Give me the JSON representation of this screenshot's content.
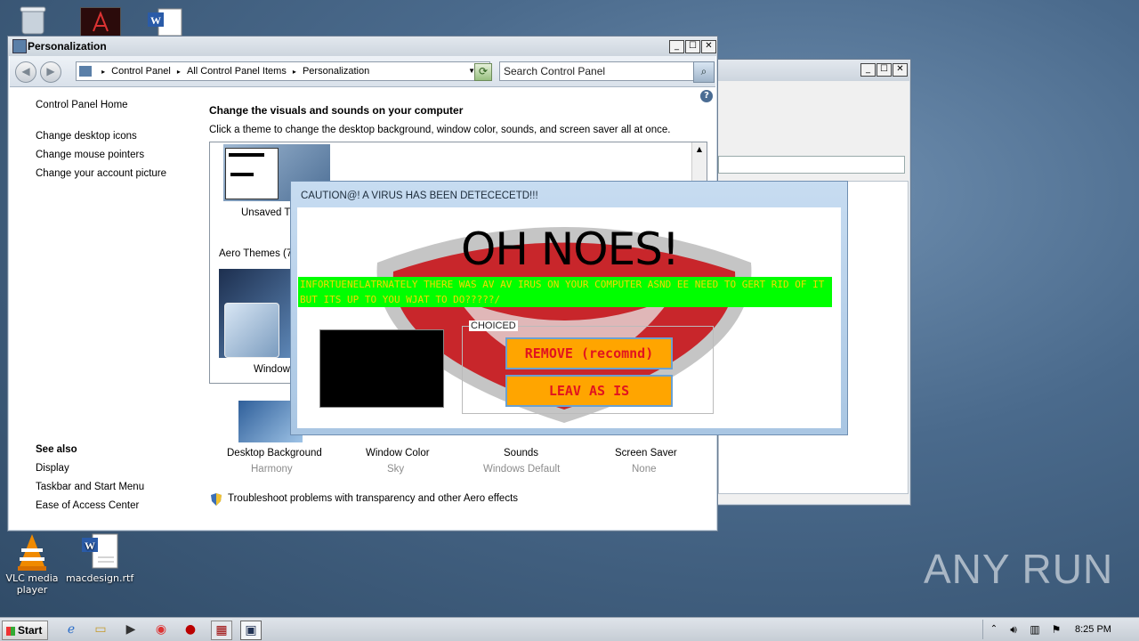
{
  "desktop": {
    "icons_top": [
      {
        "name": "recycle-bin-icon"
      },
      {
        "name": "pdf-icon"
      },
      {
        "name": "word-doc-icon"
      }
    ],
    "icons_bottom": [
      {
        "label": "VLC media player"
      },
      {
        "label": "macdesign.rtf"
      }
    ],
    "watermark": "ANY RUN"
  },
  "window": {
    "title": "Personalization",
    "controls": {
      "minimize": "_",
      "maximize": "☐",
      "close": "✕"
    },
    "address": {
      "crumbs": [
        "Control Panel",
        "All Control Panel Items",
        "Personalization"
      ]
    },
    "search": {
      "placeholder": "Search Control Panel"
    },
    "sidebar": {
      "home": "Control Panel Home",
      "links": [
        "Change desktop icons",
        "Change mouse pointers",
        "Change your account picture"
      ],
      "see_also_title": "See also",
      "see_also": [
        "Display",
        "Taskbar and Start Menu",
        "Ease of Access Center"
      ]
    },
    "main": {
      "heading": "Change the visuals and sounds on your computer",
      "subtext": "Click a theme to change the desktop background, window color, sounds, and screen saver all at once.",
      "unsaved_label": "Unsaved T",
      "aero_label": "Aero Themes (7",
      "windows_theme_label": "Window",
      "bottom": [
        {
          "title": "Desktop Background",
          "value": "Harmony"
        },
        {
          "title": "Window Color",
          "value": "Sky"
        },
        {
          "title": "Sounds",
          "value": "Windows Default"
        },
        {
          "title": "Screen Saver",
          "value": "None"
        }
      ],
      "troubleshoot": "Troubleshoot problems with transparency and other Aero effects"
    }
  },
  "popup": {
    "title": "CAUTION@! A VIRUS HAS BEEN DETECECETD!!!",
    "headline": "OH NOES!",
    "message": "INFORTUENELATRNATELY THERE WAS AV AV IRUS ON YOUR COMPUTER ASND EE NEED TO GERT RID OF IT BUT ITS UP TO YOU WJAT TO DO?????/",
    "group_label": "CHOICED",
    "remove_label": "REMOVE (recomnd)",
    "leave_label": "LEAV AS IS",
    "colors": {
      "banner": "#00ff00",
      "banner_text": "#f5d800",
      "button_bg": "#ffa500",
      "button_text": "#e1141f"
    }
  },
  "taskbar": {
    "start": "Start",
    "clock": "8:25 PM"
  }
}
